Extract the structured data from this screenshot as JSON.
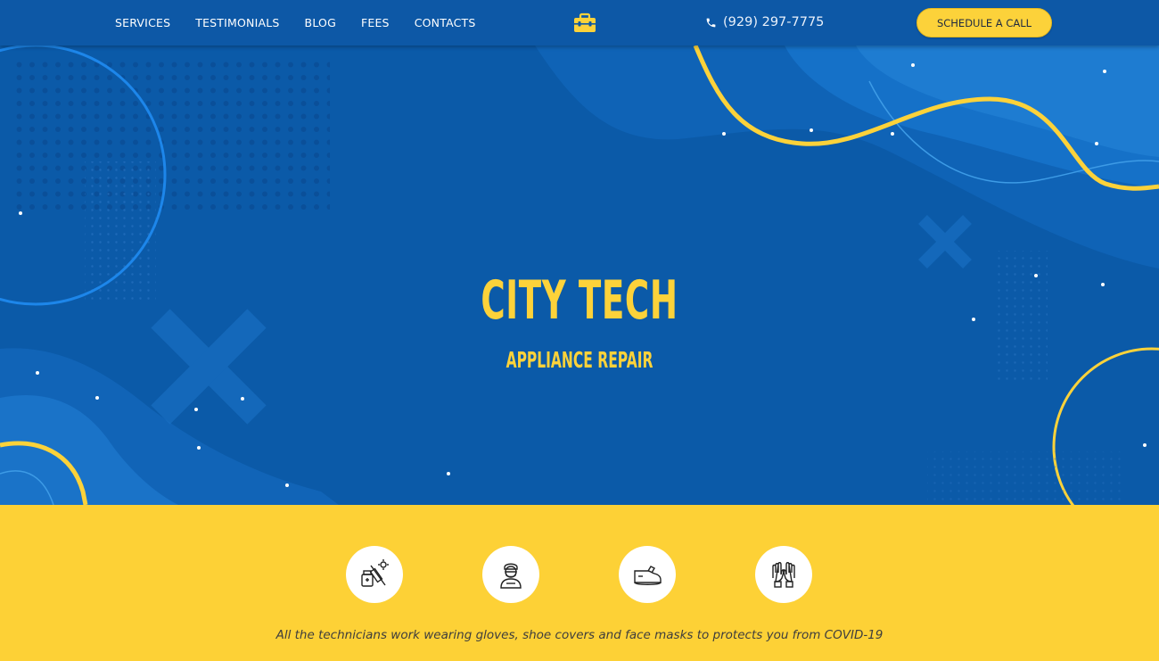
{
  "nav": {
    "items": [
      {
        "label": "SERVICES"
      },
      {
        "label": "TESTIMONIALS"
      },
      {
        "label": "BLOG"
      },
      {
        "label": "FEES"
      },
      {
        "label": "CONTACTS"
      }
    ]
  },
  "header": {
    "logo_icon": "toolbox-icon",
    "phone_icon": "phone-icon",
    "phone": "(929) 297-7775",
    "cta_label": "SCHEDULE A CALL"
  },
  "hero": {
    "title": "CITY TECH",
    "subtitle": "APPLIANCE REPAIR"
  },
  "safety": {
    "icons": [
      "sanitizer-syringe-icon",
      "masked-technician-icon",
      "shoe-cover-icon",
      "gloves-icon"
    ],
    "notice": "All the technicians work wearing gloves, shoe covers and face masks to protects you from COVID-19"
  },
  "colors": {
    "primary_blue": "#0b5aa8",
    "accent_yellow": "#fdd136",
    "text_dark": "#3d3d3d"
  }
}
